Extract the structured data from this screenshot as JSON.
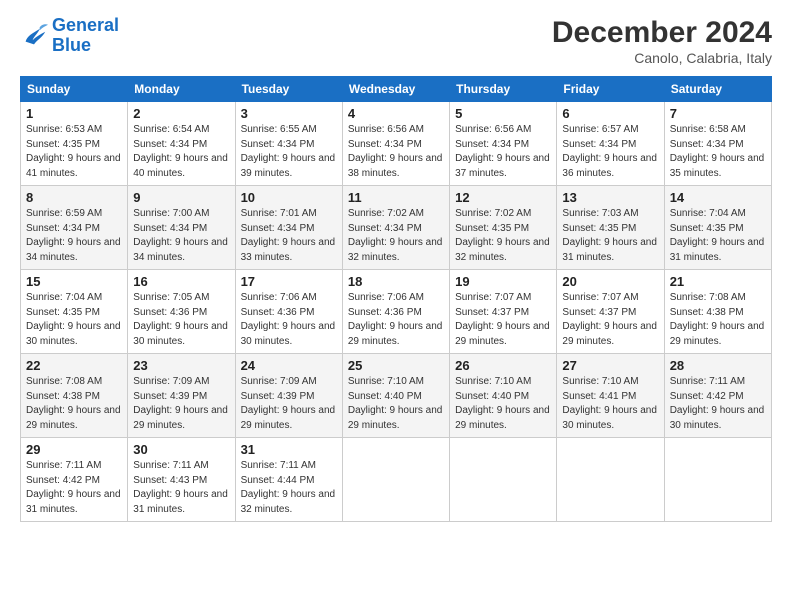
{
  "logo": {
    "line1": "General",
    "line2": "Blue"
  },
  "header": {
    "month": "December 2024",
    "location": "Canolo, Calabria, Italy"
  },
  "days": [
    "Sunday",
    "Monday",
    "Tuesday",
    "Wednesday",
    "Thursday",
    "Friday",
    "Saturday"
  ],
  "weeks": [
    [
      {
        "day": "1",
        "sunrise": "6:53 AM",
        "sunset": "4:35 PM",
        "daylight": "9 hours and 41 minutes."
      },
      {
        "day": "2",
        "sunrise": "6:54 AM",
        "sunset": "4:34 PM",
        "daylight": "9 hours and 40 minutes."
      },
      {
        "day": "3",
        "sunrise": "6:55 AM",
        "sunset": "4:34 PM",
        "daylight": "9 hours and 39 minutes."
      },
      {
        "day": "4",
        "sunrise": "6:56 AM",
        "sunset": "4:34 PM",
        "daylight": "9 hours and 38 minutes."
      },
      {
        "day": "5",
        "sunrise": "6:56 AM",
        "sunset": "4:34 PM",
        "daylight": "9 hours and 37 minutes."
      },
      {
        "day": "6",
        "sunrise": "6:57 AM",
        "sunset": "4:34 PM",
        "daylight": "9 hours and 36 minutes."
      },
      {
        "day": "7",
        "sunrise": "6:58 AM",
        "sunset": "4:34 PM",
        "daylight": "9 hours and 35 minutes."
      }
    ],
    [
      {
        "day": "8",
        "sunrise": "6:59 AM",
        "sunset": "4:34 PM",
        "daylight": "9 hours and 34 minutes."
      },
      {
        "day": "9",
        "sunrise": "7:00 AM",
        "sunset": "4:34 PM",
        "daylight": "9 hours and 34 minutes."
      },
      {
        "day": "10",
        "sunrise": "7:01 AM",
        "sunset": "4:34 PM",
        "daylight": "9 hours and 33 minutes."
      },
      {
        "day": "11",
        "sunrise": "7:02 AM",
        "sunset": "4:34 PM",
        "daylight": "9 hours and 32 minutes."
      },
      {
        "day": "12",
        "sunrise": "7:02 AM",
        "sunset": "4:35 PM",
        "daylight": "9 hours and 32 minutes."
      },
      {
        "day": "13",
        "sunrise": "7:03 AM",
        "sunset": "4:35 PM",
        "daylight": "9 hours and 31 minutes."
      },
      {
        "day": "14",
        "sunrise": "7:04 AM",
        "sunset": "4:35 PM",
        "daylight": "9 hours and 31 minutes."
      }
    ],
    [
      {
        "day": "15",
        "sunrise": "7:04 AM",
        "sunset": "4:35 PM",
        "daylight": "9 hours and 30 minutes."
      },
      {
        "day": "16",
        "sunrise": "7:05 AM",
        "sunset": "4:36 PM",
        "daylight": "9 hours and 30 minutes."
      },
      {
        "day": "17",
        "sunrise": "7:06 AM",
        "sunset": "4:36 PM",
        "daylight": "9 hours and 30 minutes."
      },
      {
        "day": "18",
        "sunrise": "7:06 AM",
        "sunset": "4:36 PM",
        "daylight": "9 hours and 29 minutes."
      },
      {
        "day": "19",
        "sunrise": "7:07 AM",
        "sunset": "4:37 PM",
        "daylight": "9 hours and 29 minutes."
      },
      {
        "day": "20",
        "sunrise": "7:07 AM",
        "sunset": "4:37 PM",
        "daylight": "9 hours and 29 minutes."
      },
      {
        "day": "21",
        "sunrise": "7:08 AM",
        "sunset": "4:38 PM",
        "daylight": "9 hours and 29 minutes."
      }
    ],
    [
      {
        "day": "22",
        "sunrise": "7:08 AM",
        "sunset": "4:38 PM",
        "daylight": "9 hours and 29 minutes."
      },
      {
        "day": "23",
        "sunrise": "7:09 AM",
        "sunset": "4:39 PM",
        "daylight": "9 hours and 29 minutes."
      },
      {
        "day": "24",
        "sunrise": "7:09 AM",
        "sunset": "4:39 PM",
        "daylight": "9 hours and 29 minutes."
      },
      {
        "day": "25",
        "sunrise": "7:10 AM",
        "sunset": "4:40 PM",
        "daylight": "9 hours and 29 minutes."
      },
      {
        "day": "26",
        "sunrise": "7:10 AM",
        "sunset": "4:40 PM",
        "daylight": "9 hours and 29 minutes."
      },
      {
        "day": "27",
        "sunrise": "7:10 AM",
        "sunset": "4:41 PM",
        "daylight": "9 hours and 30 minutes."
      },
      {
        "day": "28",
        "sunrise": "7:11 AM",
        "sunset": "4:42 PM",
        "daylight": "9 hours and 30 minutes."
      }
    ],
    [
      {
        "day": "29",
        "sunrise": "7:11 AM",
        "sunset": "4:42 PM",
        "daylight": "9 hours and 31 minutes."
      },
      {
        "day": "30",
        "sunrise": "7:11 AM",
        "sunset": "4:43 PM",
        "daylight": "9 hours and 31 minutes."
      },
      {
        "day": "31",
        "sunrise": "7:11 AM",
        "sunset": "4:44 PM",
        "daylight": "9 hours and 32 minutes."
      },
      null,
      null,
      null,
      null
    ]
  ]
}
